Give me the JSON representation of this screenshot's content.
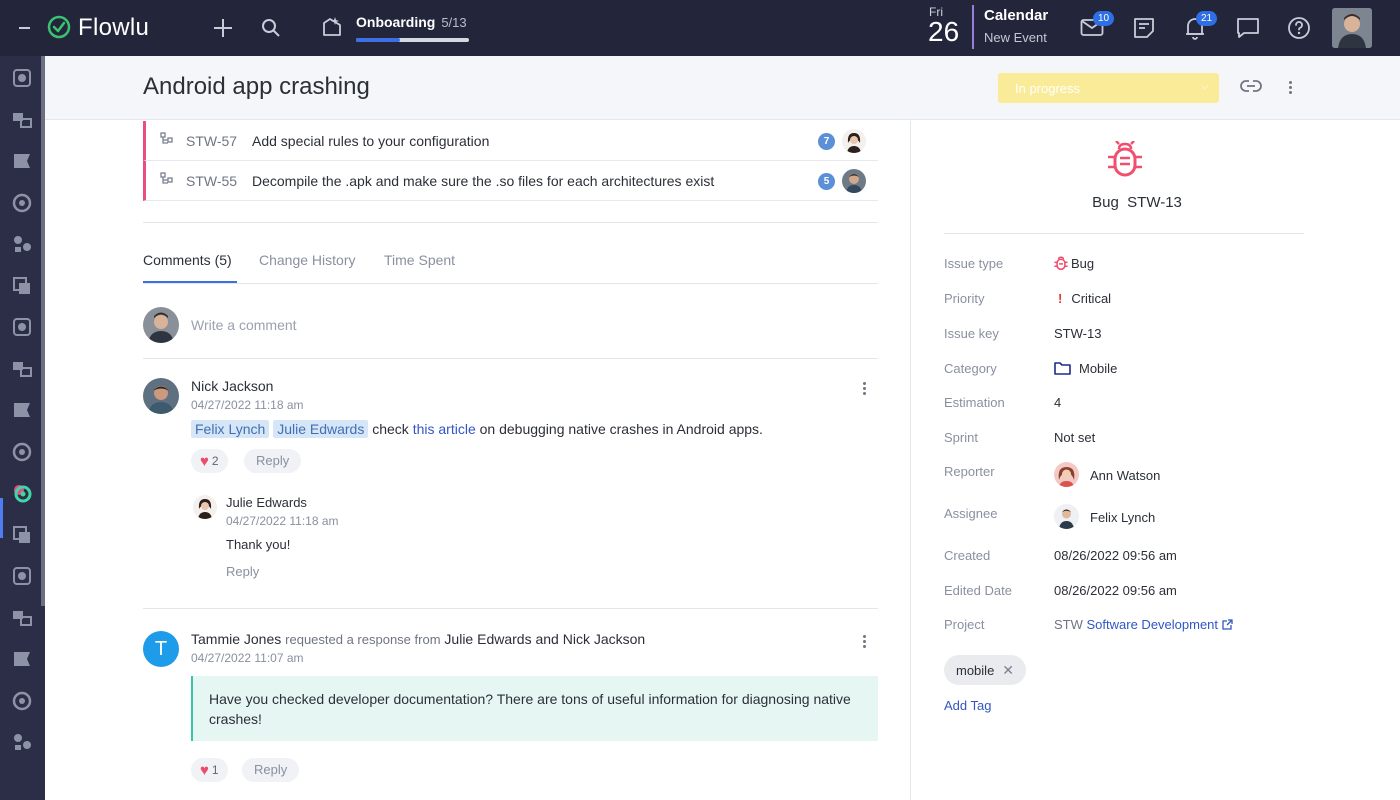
{
  "topbar": {
    "logo": "Flowlu",
    "onboarding": {
      "title": "Onboarding",
      "count": "5/13",
      "progress": 0.385
    },
    "date": {
      "dow": "Fri",
      "day": "26"
    },
    "calendar": {
      "title": "Calendar",
      "subtitle": "New Event"
    },
    "badges": {
      "mail": "10",
      "notifications": "21"
    }
  },
  "header": {
    "title": "Android app crashing",
    "status": "In progress"
  },
  "subtasks": [
    {
      "key": "STW-57",
      "title": "Add special rules to your configuration",
      "count": "7"
    },
    {
      "key": "STW-55",
      "title": "Decompile the .apk and make sure the .so files for each architectures exist",
      "count": "5"
    }
  ],
  "tabs": [
    "Comments (5)",
    "Change History",
    "Time Spent"
  ],
  "comment_input": {
    "placeholder": "Write a comment"
  },
  "comments": [
    {
      "author": "Nick Jackson",
      "date": "04/27/2022 11:18 am",
      "mention1": "Felix Lynch",
      "mention2": "Julie Edwards",
      "text_a": "check",
      "link": "this article",
      "text_b": "on debugging native crashes in Android apps.",
      "likes": "2",
      "reply_label": "Reply",
      "reply": {
        "author": "Julie Edwards",
        "date": "04/27/2022 11:18 am",
        "text": "Thank you!",
        "reply_label": "Reply"
      }
    },
    {
      "author": "Tammie Jones",
      "avatar_letter": "T",
      "action": "requested a response from",
      "target1": "Julie Edwards",
      "conj": "and",
      "target2": "Nick Jackson",
      "date": "04/27/2022 11:07 am",
      "quote": "Have you checked developer documentation? There are tons of useful information for diagnosing native crashes!",
      "likes": "1",
      "reply_label": "Reply"
    }
  ],
  "issue": {
    "type_label": "Bug",
    "key": "STW-13",
    "properties": {
      "issue_type": {
        "label": "Issue type",
        "value": "Bug"
      },
      "priority": {
        "label": "Priority",
        "value": "Critical"
      },
      "issue_key": {
        "label": "Issue key",
        "value": "STW-13"
      },
      "category": {
        "label": "Category",
        "value": "Mobile"
      },
      "estimation": {
        "label": "Estimation",
        "value": "4"
      },
      "sprint": {
        "label": "Sprint",
        "value": "Not set"
      },
      "reporter": {
        "label": "Reporter",
        "value": "Ann Watson"
      },
      "assignee": {
        "label": "Assignee",
        "value": "Felix Lynch"
      },
      "created": {
        "label": "Created",
        "value": "08/26/2022 09:56 am"
      },
      "edited": {
        "label": "Edited Date",
        "value": "08/26/2022 09:56 am"
      },
      "project": {
        "label": "Project",
        "prefix": "STW",
        "value": "Software Development"
      }
    },
    "tags": [
      "mobile"
    ],
    "add_tag": "Add Tag"
  },
  "colors": {
    "topbar": "#23253a",
    "sidebar": "#2b2e46",
    "accent": "#3d6ee3",
    "status": "#f9eb97",
    "bug": "#f0506e",
    "quote_bg": "#e6f7f3"
  }
}
